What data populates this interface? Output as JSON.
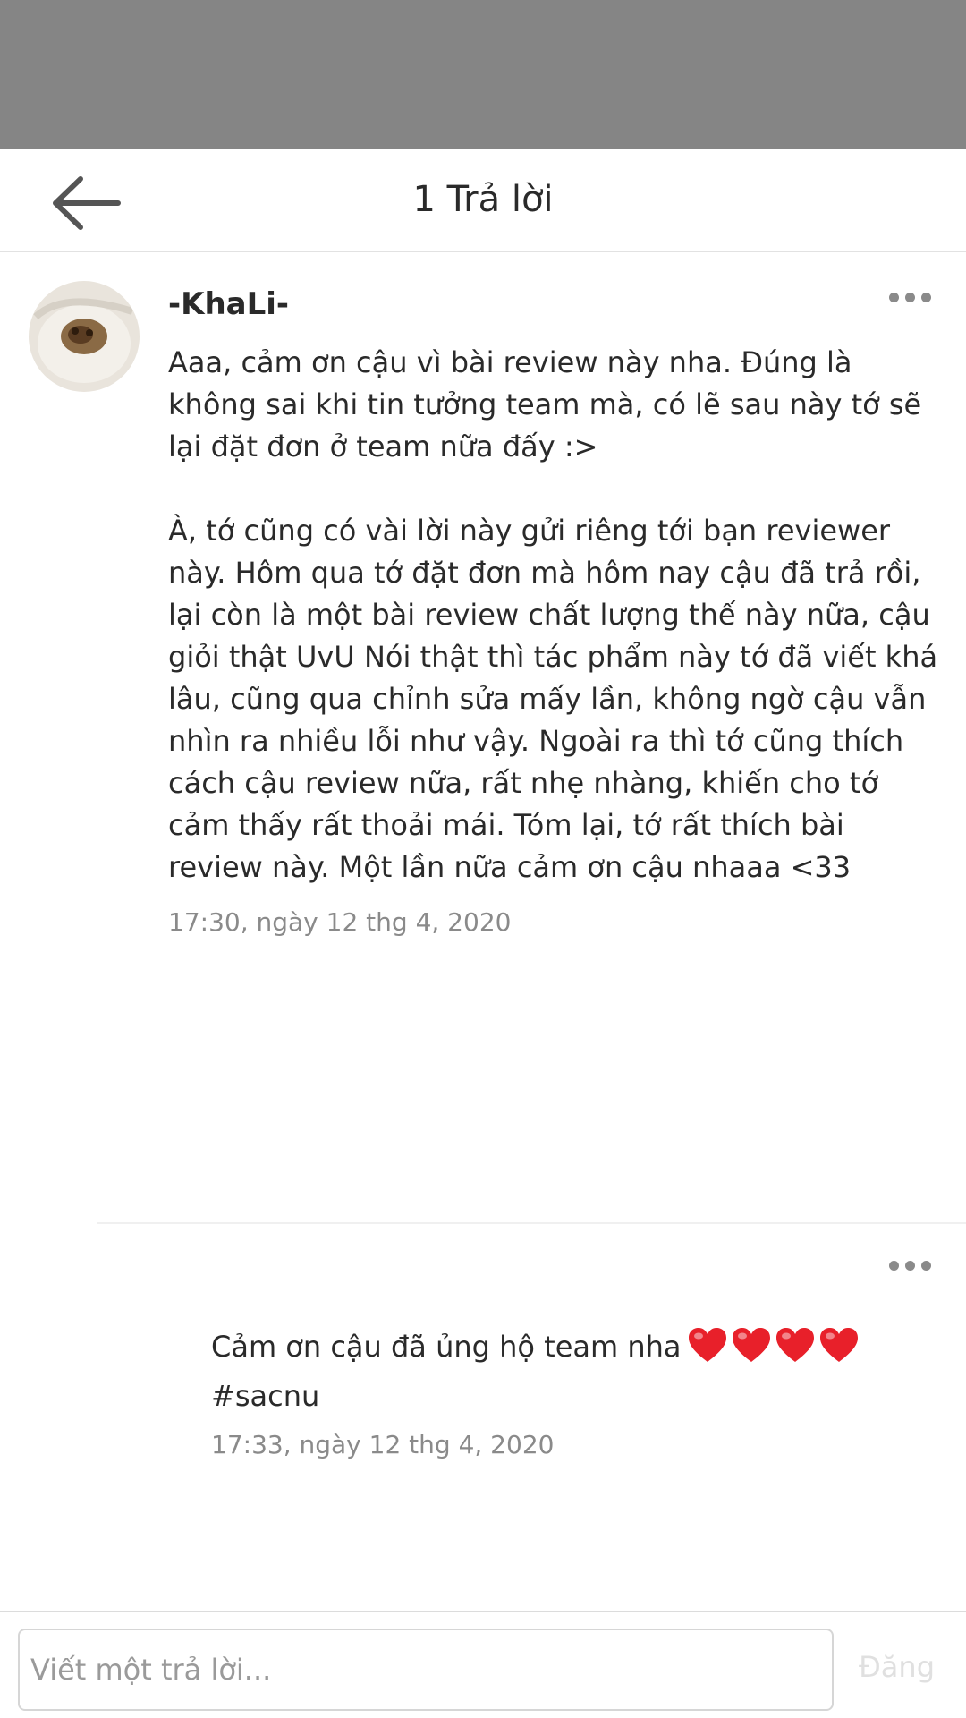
{
  "header": {
    "title": "1 Trả lời"
  },
  "comment": {
    "author": "-KhaLi-",
    "body": "Aaa, cảm ơn cậu vì bài review này nha. Đúng là không sai khi tin tưởng team mà, có lẽ sau này tớ sẽ lại đặt đơn ở team nữa đấy :>\n\nÀ, tớ cũng có vài lời này gửi riêng tới bạn reviewer này. Hôm qua tớ đặt đơn mà hôm nay cậu đã trả rồi, lại còn là một bài review chất lượng thế này nữa, cậu giỏi thật UvU Nói thật thì tác phẩm này tớ đã viết khá lâu, cũng qua chỉnh sửa mấy lần, không ngờ cậu vẫn nhìn ra nhiều lỗi như vậy. Ngoài ra thì tớ cũng thích cách cậu review nữa, rất nhẹ nhàng, khiến cho tớ cảm thấy rất thoải mái. Tóm lại, tớ rất thích bài review này. Một lần nữa cảm ơn cậu nhaaa <33",
    "timestamp": "17:30, ngày 12 thg 4, 2020"
  },
  "reply": {
    "text": "Cảm ơn cậu đã ủng hộ team nha",
    "hearts_count": 4,
    "heart_color": "#e8202a",
    "hashtag": "#sacnu",
    "timestamp": "17:33, ngày 12 thg 4, 2020"
  },
  "footer": {
    "input_placeholder": "Viết một trả lời...",
    "post_label": "Đăng"
  },
  "colors": {
    "status_bar": "#858585",
    "text": "#2a2a2a",
    "muted": "#8a8a8a",
    "post_disabled": "#e0e0e0"
  }
}
